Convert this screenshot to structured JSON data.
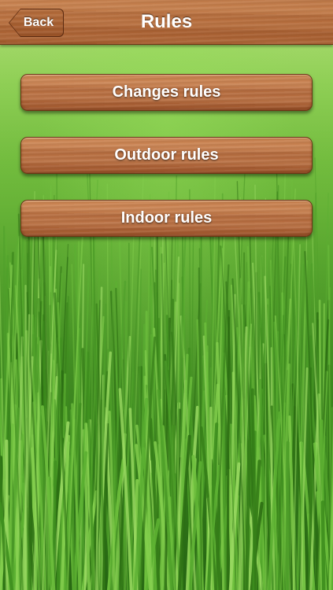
{
  "nav": {
    "title": "Rules",
    "back_label": "Back"
  },
  "menu": {
    "items": [
      {
        "label": "Changes rules"
      },
      {
        "label": "Outdoor rules"
      },
      {
        "label": "Indoor rules"
      }
    ]
  },
  "colors": {
    "wood": "#b86f3e",
    "wood_dark": "#6b3515",
    "grass_light": "#b4e07a",
    "grass_dark": "#276a14",
    "text": "#ffffff"
  },
  "icons": {
    "back": "chevron-left-shaped-button"
  }
}
